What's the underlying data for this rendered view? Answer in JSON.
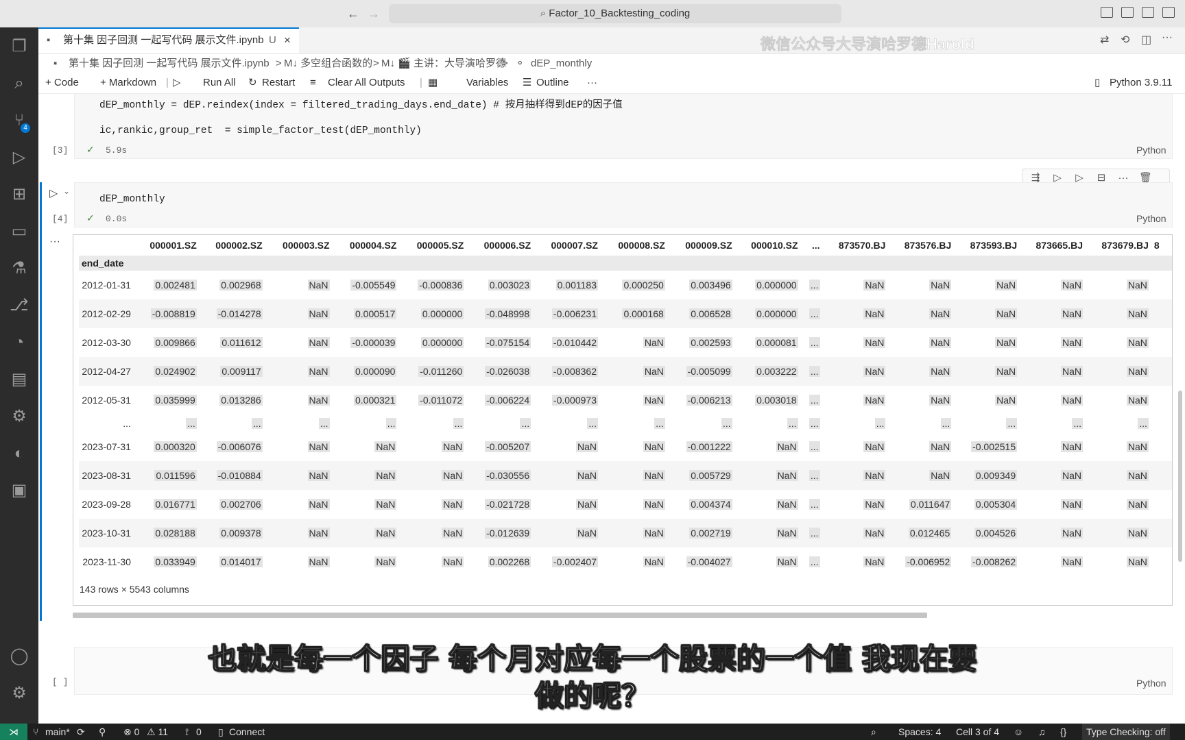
{
  "titlebar": {
    "back": "←",
    "forward": "→",
    "search_text": "Factor_10_Backtesting_coding"
  },
  "tab": {
    "title": "第十集 因子回测 一起写代码 展示文件.ipynb",
    "status": "U",
    "close": "×"
  },
  "activity": {
    "source_control_badge": "4"
  },
  "breadcrumb": {
    "file": "第十集 因子回测 一起写代码 展示文件.ipynb",
    "section1": "M↓ 多空组合函数的",
    "section2": "M↓ 🎬 主讲：大导演哈罗德",
    "section3": "dEP_monthly",
    "sep": ">"
  },
  "toolbar": {
    "code": "+ Code",
    "markdown": "+ Markdown",
    "run_all": "Run All",
    "restart": "Restart",
    "clear": "Clear All Outputs",
    "variables": "Variables",
    "outline": "Outline",
    "more": "···",
    "kernel": "Python 3.9.11"
  },
  "cell3": {
    "line1": "dEP_monthly = dEP.reindex(index = filtered_trading_days.end_date) # 按月抽样得到dEP的因子值",
    "line2": "ic,rankic,group_ret  = simple_factor_test(dEP_monthly)",
    "exec_count": "[3]",
    "check": "✓",
    "time": "5.9s",
    "lang": "Python"
  },
  "cell4": {
    "line1": "dEP_monthly",
    "exec_count": "[4]",
    "check": "✓",
    "time": "0.0s",
    "lang": "Python",
    "output_more": "···"
  },
  "cell5": {
    "exec_count": "[ ]",
    "lang": "Python"
  },
  "dataframe": {
    "columns": [
      "000001.SZ",
      "000002.SZ",
      "000003.SZ",
      "000004.SZ",
      "000005.SZ",
      "000006.SZ",
      "000007.SZ",
      "000008.SZ",
      "000009.SZ",
      "000010.SZ",
      "...",
      "873570.BJ",
      "873576.BJ",
      "873593.BJ",
      "873665.BJ",
      "873679.BJ",
      "8"
    ],
    "index_name": "end_date",
    "rows": [
      {
        "date": "2012-01-31",
        "values": [
          "0.002481",
          "0.002968",
          "NaN",
          "-0.005549",
          "-0.000836",
          "0.003023",
          "0.001183",
          "0.000250",
          "0.003496",
          "0.000000",
          "...",
          "NaN",
          "NaN",
          "NaN",
          "NaN",
          "NaN"
        ]
      },
      {
        "date": "2012-02-29",
        "values": [
          "-0.008819",
          "-0.014278",
          "NaN",
          "0.000517",
          "0.000000",
          "-0.048998",
          "-0.006231",
          "0.000168",
          "0.006528",
          "0.000000",
          "...",
          "NaN",
          "NaN",
          "NaN",
          "NaN",
          "NaN"
        ]
      },
      {
        "date": "2012-03-30",
        "values": [
          "0.009866",
          "0.011612",
          "NaN",
          "-0.000039",
          "0.000000",
          "-0.075154",
          "-0.010442",
          "NaN",
          "0.002593",
          "0.000081",
          "...",
          "NaN",
          "NaN",
          "NaN",
          "NaN",
          "NaN"
        ]
      },
      {
        "date": "2012-04-27",
        "values": [
          "0.024902",
          "0.009117",
          "NaN",
          "0.000090",
          "-0.011260",
          "-0.026038",
          "-0.008362",
          "NaN",
          "-0.005099",
          "0.003222",
          "...",
          "NaN",
          "NaN",
          "NaN",
          "NaN",
          "NaN"
        ]
      },
      {
        "date": "2012-05-31",
        "values": [
          "0.035999",
          "0.013286",
          "NaN",
          "0.000321",
          "-0.011072",
          "-0.006224",
          "-0.000973",
          "NaN",
          "-0.006213",
          "0.003018",
          "...",
          "NaN",
          "NaN",
          "NaN",
          "NaN",
          "NaN"
        ]
      },
      {
        "date": "...",
        "values": [
          "...",
          "...",
          "...",
          "...",
          "...",
          "...",
          "...",
          "...",
          "...",
          "...",
          "...",
          "...",
          "...",
          "...",
          "...",
          "..."
        ]
      },
      {
        "date": "2023-07-31",
        "values": [
          "0.000320",
          "-0.006076",
          "NaN",
          "NaN",
          "NaN",
          "-0.005207",
          "NaN",
          "NaN",
          "-0.001222",
          "NaN",
          "...",
          "NaN",
          "NaN",
          "-0.002515",
          "NaN",
          "NaN"
        ]
      },
      {
        "date": "2023-08-31",
        "values": [
          "0.011596",
          "-0.010884",
          "NaN",
          "NaN",
          "NaN",
          "-0.030556",
          "NaN",
          "NaN",
          "0.005729",
          "NaN",
          "...",
          "NaN",
          "NaN",
          "0.009349",
          "NaN",
          "NaN"
        ]
      },
      {
        "date": "2023-09-28",
        "values": [
          "0.016771",
          "0.002706",
          "NaN",
          "NaN",
          "NaN",
          "-0.021728",
          "NaN",
          "NaN",
          "0.004374",
          "NaN",
          "...",
          "NaN",
          "0.011647",
          "0.005304",
          "NaN",
          "NaN"
        ]
      },
      {
        "date": "2023-10-31",
        "values": [
          "0.028188",
          "0.009378",
          "NaN",
          "NaN",
          "NaN",
          "-0.012639",
          "NaN",
          "NaN",
          "0.002719",
          "NaN",
          "...",
          "NaN",
          "0.012465",
          "0.004526",
          "NaN",
          "NaN"
        ]
      },
      {
        "date": "2023-11-30",
        "values": [
          "0.033949",
          "0.014017",
          "NaN",
          "NaN",
          "NaN",
          "0.002268",
          "-0.002407",
          "NaN",
          "-0.004027",
          "NaN",
          "...",
          "NaN",
          "-0.006952",
          "-0.008262",
          "NaN",
          "NaN"
        ]
      }
    ],
    "shape": "143 rows × 5543 columns"
  },
  "subtitles": {
    "line1": "也就是每一个因子 每个月对应每一个股票的一个值 我现在要",
    "line2": "做的呢？"
  },
  "statusbar": {
    "branch": "main*",
    "errors": "⊗ 0",
    "warnings": "⚠ 11",
    "ports": "0",
    "connect": "Connect",
    "spaces": "Spaces: 4",
    "cell": "Cell 3 of 4",
    "type_checking": "Type Checking: off"
  }
}
